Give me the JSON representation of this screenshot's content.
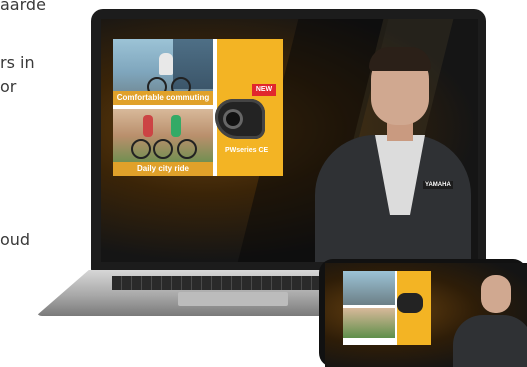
{
  "side_text": {
    "line1": "aarde",
    "line2": "rs in",
    "line3": "or",
    "line4": "oud"
  },
  "slide": {
    "caption_top": "Comfortable commuting",
    "caption_bottom": "Daily city ride",
    "badge": "NEW",
    "product": "PWseries CE"
  },
  "presenter": {
    "jacket_badge": "YAMAHA"
  }
}
